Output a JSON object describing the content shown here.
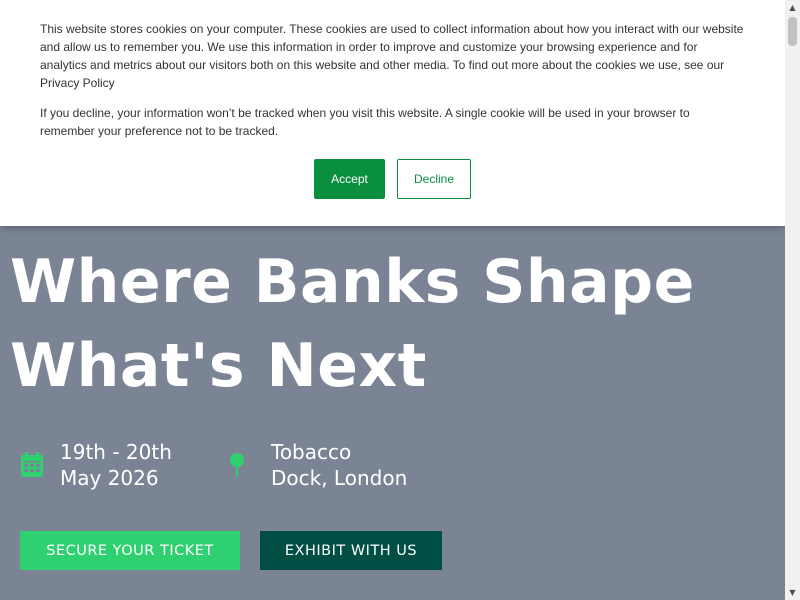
{
  "hero": {
    "title_line1": "Where Banks Shape",
    "title_line2": "What's Next",
    "date_line1": "19th - 20th",
    "date_line2": "May 2026",
    "venue_line1": "Tobacco",
    "venue_line2": "Dock, London",
    "ticket_button": "SECURE YOUR TICKET",
    "exhibit_button": "EXHIBIT WITH US",
    "icons": {
      "date": "calendar-icon",
      "venue": "map-pin-icon"
    }
  },
  "cookie_banner": {
    "paragraph1": "This website stores cookies on your computer. These cookies are used to collect information about how you interact with our website and allow us to remember you. We use this information in order to improve and customize your browsing experience and for analytics and metrics about our visitors both on this website and other media. To find out more about the cookies we use, see our Privacy Policy",
    "paragraph2": "If you decline, your information won’t be tracked when you visit this website. A single cookie will be used in your browser to remember your preference not to be tracked.",
    "accept_label": "Accept",
    "decline_label": "Decline"
  },
  "colors": {
    "hero_background": "#7b8494",
    "accent_green": "#2ed06f",
    "dark_green": "#014e44",
    "cookie_green": "#0a8f3e"
  },
  "scrollbar": {
    "up_arrow": "▲",
    "down_arrow": "▼"
  }
}
